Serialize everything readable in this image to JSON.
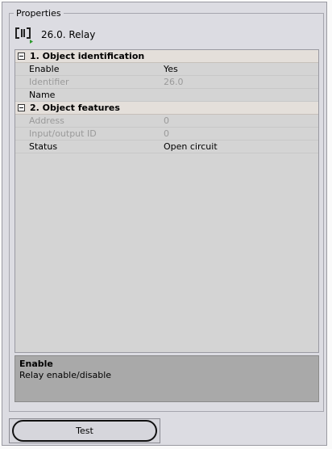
{
  "properties": {
    "group_title": "Properties",
    "object_title": "26.0. Relay",
    "sections": [
      {
        "title": "1. Object identification",
        "rows": [
          {
            "name": "Enable",
            "value": "Yes",
            "disabled": false
          },
          {
            "name": "Identifier",
            "value": "26.0",
            "disabled": true
          },
          {
            "name": "Name",
            "value": "",
            "disabled": false
          }
        ]
      },
      {
        "title": "2. Object features",
        "rows": [
          {
            "name": "Address",
            "value": "0",
            "disabled": true
          },
          {
            "name": "Input/output ID",
            "value": "0",
            "disabled": true
          },
          {
            "name": "Status",
            "value": "Open circuit",
            "disabled": false
          }
        ]
      }
    ]
  },
  "description": {
    "title": "Enable",
    "text": "Relay enable/disable"
  },
  "actions": {
    "test_label": "Test"
  },
  "colors": {
    "panel_bg": "#dcdce2",
    "grid_bg": "#d4d4d4",
    "section_bg": "#e4dfda",
    "disabled_text": "#9a9a9a",
    "description_bg": "#a9a9a9",
    "icon_accent": "#2d9a2d"
  },
  "icons": {
    "object": "relay-icon",
    "collapse": "minus-box-icon"
  }
}
